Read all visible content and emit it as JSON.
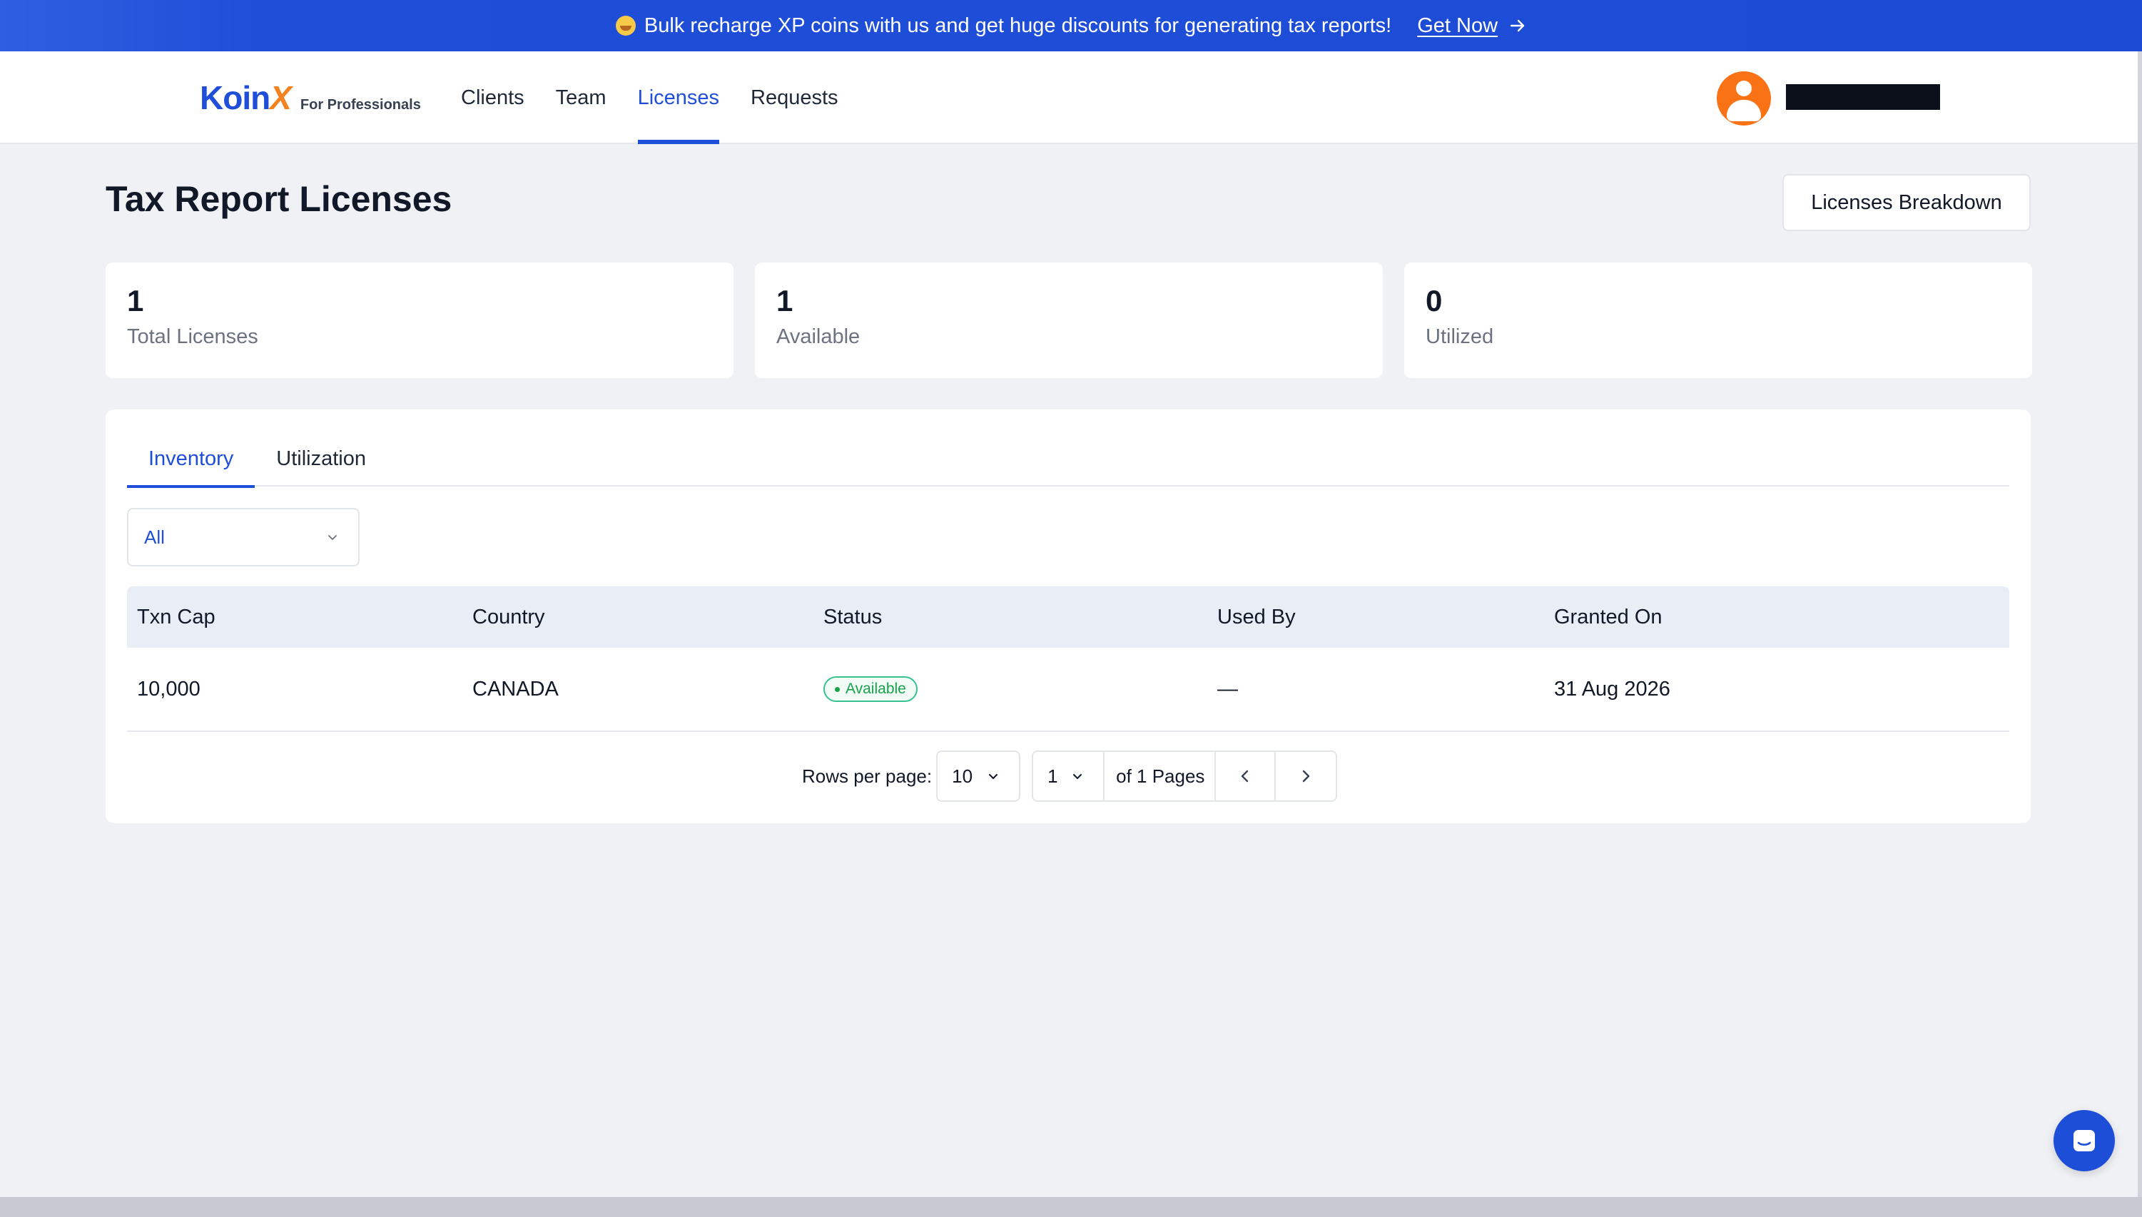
{
  "banner": {
    "message": "Bulk recharge XP coins with us and get huge discounts for generating tax reports!",
    "cta": "Get Now"
  },
  "header": {
    "logo_main": "Koin",
    "logo_x": "X",
    "logo_sub": "For Professionals",
    "nav": [
      "Clients",
      "Team",
      "Licenses",
      "Requests"
    ],
    "active_nav": "Licenses"
  },
  "page": {
    "title": "Tax Report Licenses",
    "breakdown_button": "Licenses Breakdown"
  },
  "stats": [
    {
      "value": "1",
      "label": "Total Licenses"
    },
    {
      "value": "1",
      "label": "Available"
    },
    {
      "value": "0",
      "label": "Utilized"
    }
  ],
  "tabs": [
    "Inventory",
    "Utilization"
  ],
  "active_tab": "Inventory",
  "filter": {
    "selected": "All"
  },
  "table": {
    "headers": [
      "Txn Cap",
      "Country",
      "Status",
      "Used By",
      "Granted On"
    ],
    "rows": [
      {
        "txn_cap": "10,000",
        "country": "CANADA",
        "status": "Available",
        "used_by": "—",
        "granted_on": "31 Aug 2026"
      }
    ]
  },
  "pagination": {
    "rows_per_page_label": "Rows per page:",
    "rows_per_page": "10",
    "current_page": "1",
    "of_pages": "of 1 Pages"
  },
  "colors": {
    "accent": "#1f4fd8",
    "brand_orange": "#f58220",
    "status_green": "#16a34a",
    "background": "#f0f1f5"
  },
  "icons": [
    "chevron-down-icon",
    "chevron-left-icon",
    "chevron-right-icon",
    "arrow-right-icon",
    "user-icon",
    "chat-icon"
  ]
}
